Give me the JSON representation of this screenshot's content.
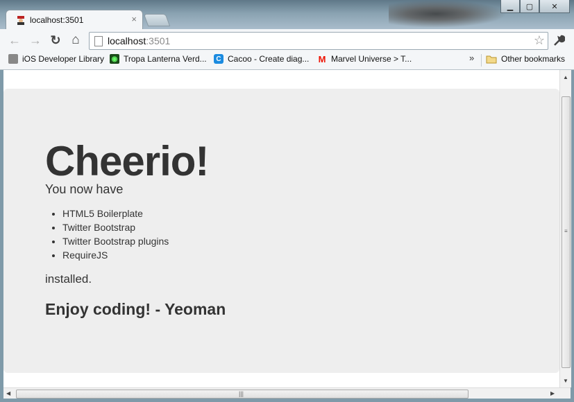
{
  "browser": {
    "tab": {
      "title": "localhost:3501"
    },
    "window_controls": {
      "minimize": "▁",
      "maximize": "▢",
      "close": "✕"
    },
    "nav": {
      "back": "←",
      "forward": "→",
      "reload": "↻",
      "home": "⌂"
    },
    "omnibox": {
      "host": "localhost",
      "port": ":3501"
    },
    "bookmarks": [
      {
        "label": "iOS Developer Library",
        "icon": "apple-icon"
      },
      {
        "label": "Tropa Lanterna Verd...",
        "icon": "lantern-icon"
      },
      {
        "label": "Cacoo - Create diag...",
        "icon": "cacoo-icon"
      },
      {
        "label": "Marvel Universe > T...",
        "icon": "marvel-icon"
      }
    ],
    "bookmarks_overflow": "»",
    "other_bookmarks": "Other bookmarks"
  },
  "page": {
    "heading": "Cheerio!",
    "lead": "You now have",
    "items": [
      "HTML5 Boilerplate",
      "Twitter Bootstrap",
      "Twitter Bootstrap plugins",
      "RequireJS"
    ],
    "installed": "installed.",
    "footer_heading": "Enjoy coding! - Yeoman"
  },
  "colors": {
    "hero_bg": "#eeeeee",
    "text": "#333333"
  }
}
